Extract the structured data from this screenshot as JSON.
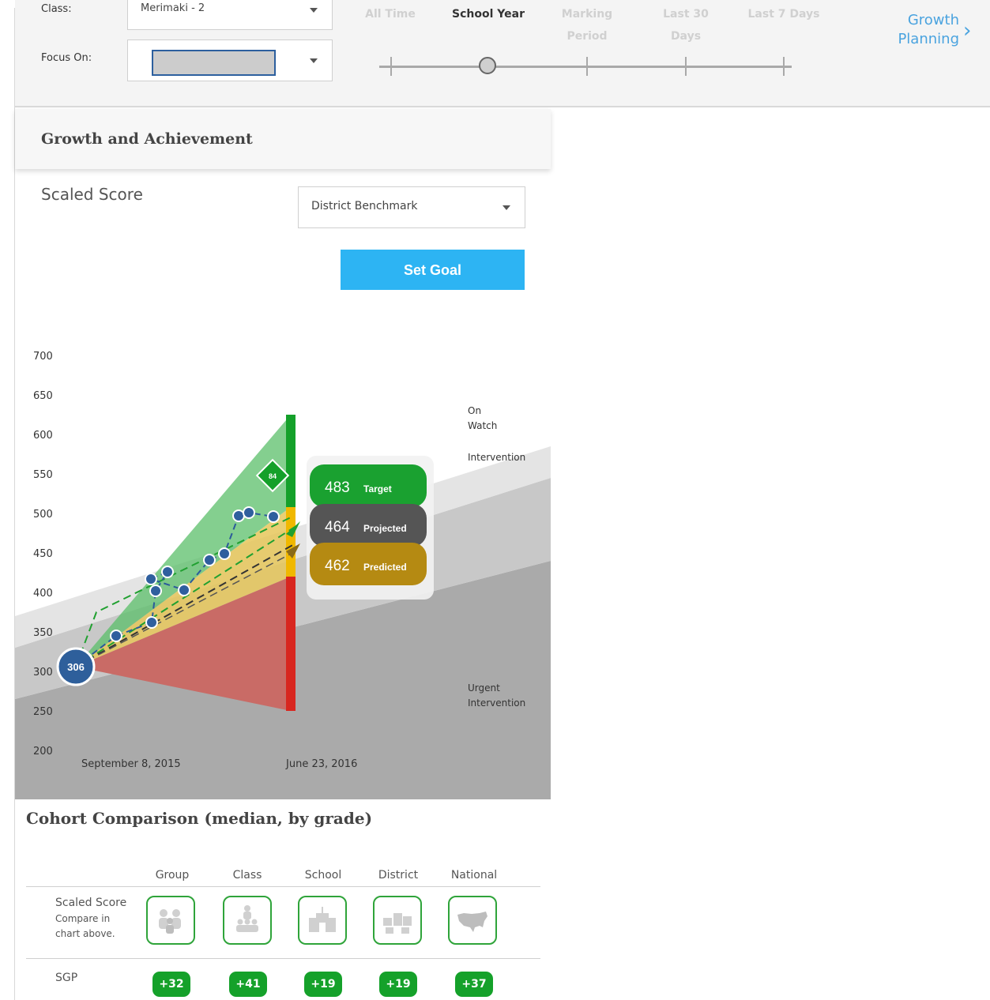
{
  "toolbar": {
    "class_label": "Class:",
    "class_value": "Merimaki - 2",
    "focus_label": "Focus On:",
    "focus_value": "",
    "time_ranges": [
      {
        "label": "All Time"
      },
      {
        "label": "School Year"
      },
      {
        "label": "Marking Period"
      },
      {
        "label": "Last 30 Days"
      },
      {
        "label": "Last 7 Days"
      }
    ],
    "selected_range": "School Year",
    "growth_link": "Growth Planning"
  },
  "card": {
    "title": "Growth and Achievement",
    "score_title": "Scaled Score",
    "benchmark_select": "District Benchmark",
    "set_goal": "Set Goal"
  },
  "chart_data": {
    "type": "line",
    "ylim": [
      200,
      700
    ],
    "y_ticks": [
      700,
      650,
      600,
      550,
      500,
      450,
      400,
      350,
      300,
      250,
      200
    ],
    "x_labels": [
      "September 8, 2015",
      "June 23, 2016"
    ],
    "start_score": 306,
    "goal_marker": "84",
    "series": [
      {
        "values": [
          306,
          345,
          362,
          402,
          426,
          417,
          403,
          441,
          449,
          497,
          501,
          496
        ]
      }
    ],
    "band_labels": [
      "On Watch",
      "Intervention",
      "Urgent Intervention"
    ],
    "outcomes": [
      {
        "value": "483",
        "label": "Target",
        "color": "#1aa130"
      },
      {
        "value": "464",
        "label": "Projected",
        "color": "#555555"
      },
      {
        "value": "462",
        "label": "Predicted",
        "color": "#b58a12"
      }
    ]
  },
  "cohort": {
    "title": "Cohort Comparison (median, by grade)",
    "columns": [
      "Group",
      "Class",
      "School",
      "District",
      "National"
    ],
    "scaled_row_label": "Scaled Score",
    "scaled_row_sub1": "Compare in",
    "scaled_row_sub2": "chart above.",
    "sgp_label": "SGP",
    "sgp_values": [
      "+32",
      "+41",
      "+19",
      "+19",
      "+37"
    ]
  }
}
